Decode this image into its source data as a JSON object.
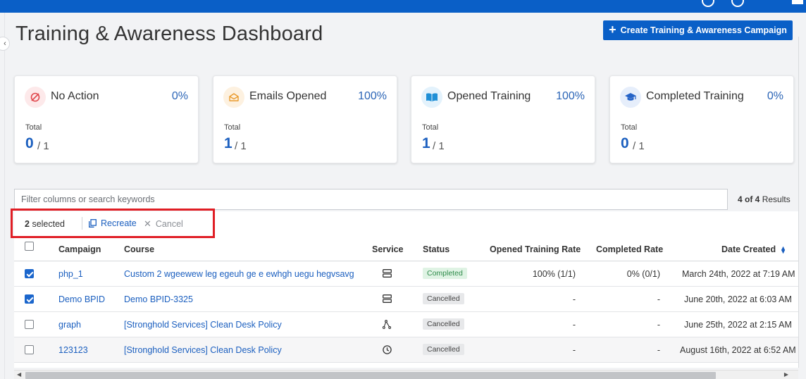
{
  "page": {
    "title": "Training & Awareness Dashboard",
    "create_button": "Create Training & Awareness Campaign"
  },
  "cards": [
    {
      "title": "No Action",
      "percent": "0%",
      "total_label": "Total",
      "total_value": "0",
      "total_of": "/ 1",
      "icon": "no-action-icon",
      "icon_color": "#e0474c",
      "icon_bg": "#fde9ea"
    },
    {
      "title": "Emails Opened",
      "percent": "100%",
      "total_label": "Total",
      "total_value": "1",
      "total_of": "/ 1",
      "icon": "envelope-open-icon",
      "icon_color": "#e99a2c",
      "icon_bg": "#fdf1e0"
    },
    {
      "title": "Opened Training",
      "percent": "100%",
      "total_label": "Total",
      "total_value": "1",
      "total_of": "/ 1",
      "icon": "book-open-icon",
      "icon_color": "#1f8fd6",
      "icon_bg": "#e3f2fc"
    },
    {
      "title": "Completed Training",
      "percent": "0%",
      "total_label": "Total",
      "total_value": "0",
      "total_of": "/ 1",
      "icon": "graduation-cap-icon",
      "icon_color": "#2563c7",
      "icon_bg": "#e6eefb"
    }
  ],
  "filter": {
    "placeholder": "Filter columns or search keywords",
    "results_count": "4 of 4",
    "results_label": "Results"
  },
  "selection": {
    "count": "2",
    "count_label": "selected",
    "recreate": "Recreate",
    "cancel": "Cancel"
  },
  "table": {
    "headers": {
      "campaign": "Campaign",
      "course": "Course",
      "service": "Service",
      "status": "Status",
      "opened_rate": "Opened Training Rate",
      "completed_rate": "Completed Rate",
      "date_created": "Date Created"
    },
    "rows": [
      {
        "checked": true,
        "campaign": "php_1",
        "course": "Custom 2 wgeewew leg egeuh ge e ewhgh uegu hegvsavg",
        "service_icon": "server-icon",
        "status": "Completed",
        "opened_rate": "100% (1/1)",
        "completed_rate": "0% (0/1)",
        "date_created": "March 24th, 2022 at 7:19 AM"
      },
      {
        "checked": true,
        "campaign": "Demo BPID",
        "course": "Demo BPID-3325",
        "service_icon": "server-icon",
        "status": "Cancelled",
        "opened_rate": "-",
        "completed_rate": "-",
        "date_created": "June 20th, 2022 at 6:03 AM"
      },
      {
        "checked": false,
        "campaign": "graph",
        "course": "[Stronghold Services] Clean Desk Policy",
        "service_icon": "graph-icon",
        "status": "Cancelled",
        "opened_rate": "-",
        "completed_rate": "-",
        "date_created": "June 25th, 2022 at 2:15 AM"
      },
      {
        "checked": false,
        "campaign": "123123",
        "course": "[Stronghold Services] Clean Desk Policy",
        "service_icon": "clock-icon",
        "status": "Cancelled",
        "opened_rate": "-",
        "completed_rate": "-",
        "date_created": "August 16th, 2022 at 6:52 AM"
      }
    ]
  },
  "colors": {
    "primary": "#0a5fc7",
    "link": "#1b5fbf",
    "highlight": "#e01e25"
  }
}
